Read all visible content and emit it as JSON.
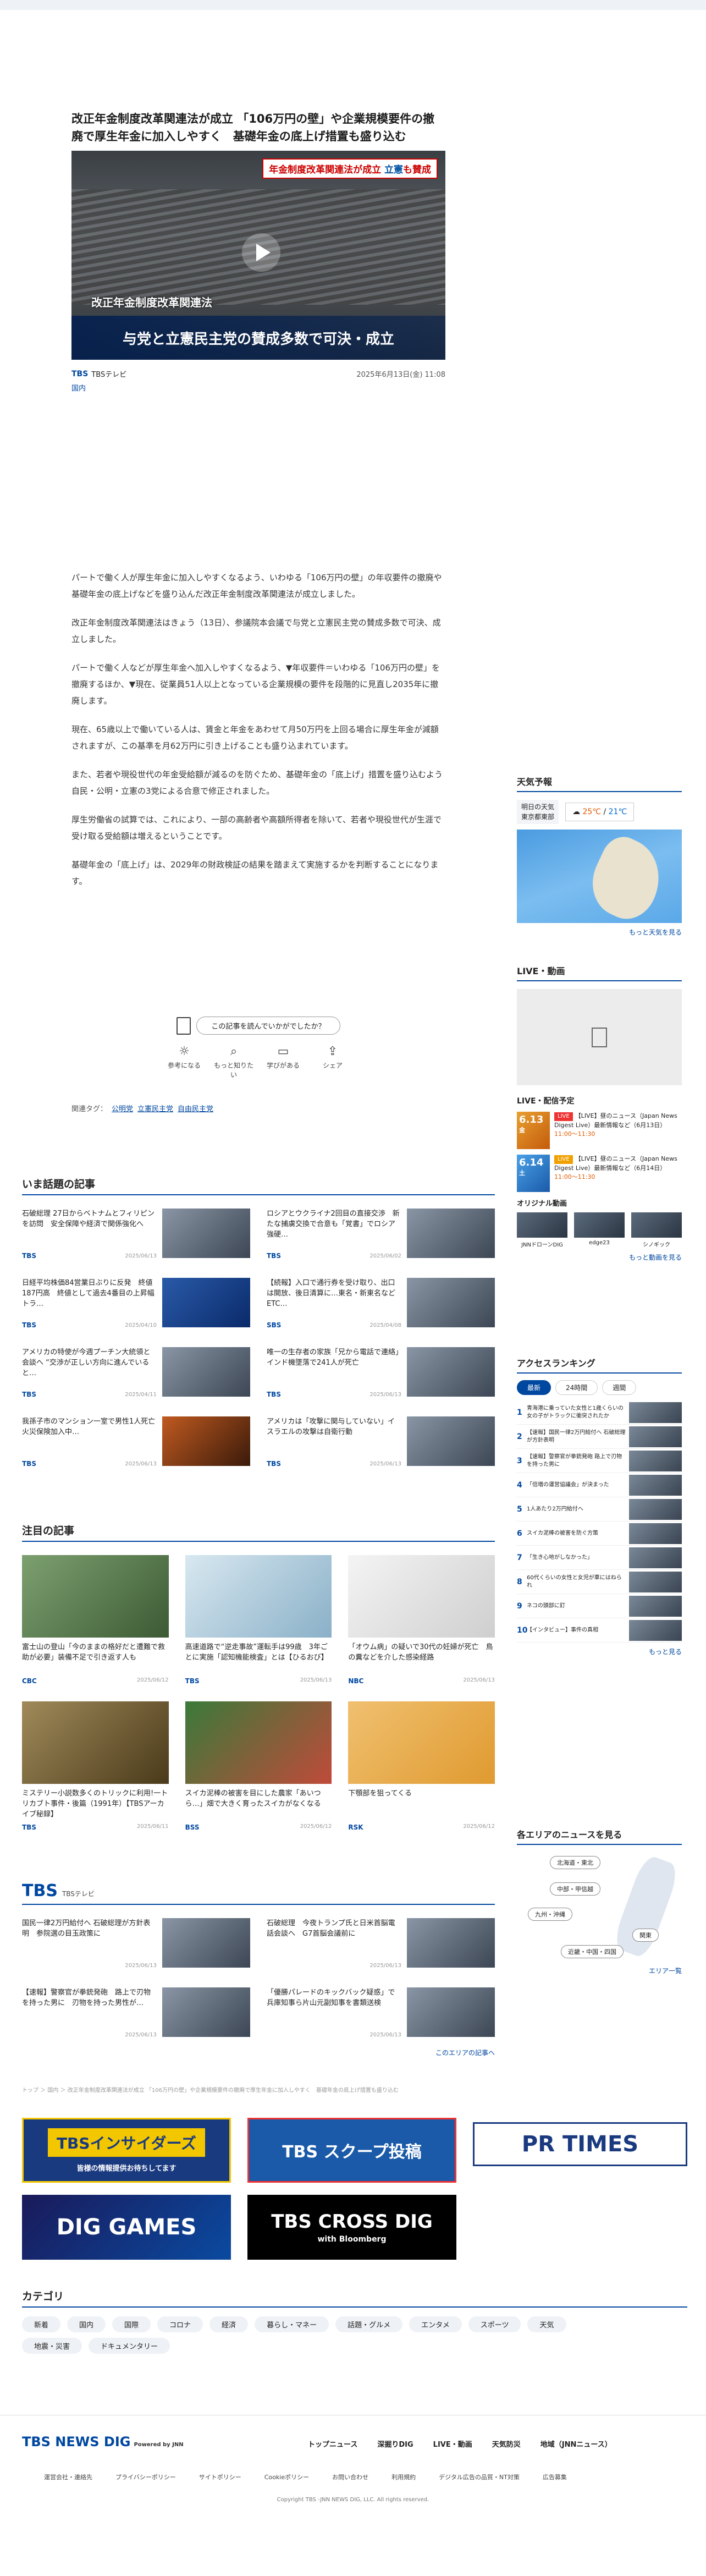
{
  "article": {
    "title": "改正年金制度改革関連法が成立 「106万円の壁」や企業規模要件の撤廃で厚生年金に加入しやすく　基礎年金の底上げ措置も盛り込む",
    "hero_badge_pre": "年金制度改革関連法が成立 ",
    "hero_badge_blue": "立憲",
    "hero_badge_post": "も賛成",
    "hero_caption1": "改正年金制度改革関連法",
    "hero_caption2": "与党と立憲民主党の賛成多数で可決・成立",
    "source_logo": "TBS",
    "source_name": "TBSテレビ",
    "date": "2025年6月13日(金) 11:08",
    "category": "国内",
    "paragraphs": [
      "パートで働く人が厚生年金に加入しやすくなるよう、いわゆる「106万円の壁」の年収要件の撤廃や基礎年金の底上げなどを盛り込んだ改正年金制度改革関連法が成立しました。",
      "改正年金制度改革関連法はきょう（13日）、参議院本会議で与党と立憲民主党の賛成多数で可決、成立しました。",
      "パートで働く人などが厚生年金へ加入しやすくなるよう、▼年収要件＝いわゆる「106万円の壁」を撤廃するほか、▼現在、従業員51人以上となっている企業規模の要件を段階的に見直し2035年に撤廃します。",
      "現在、65歳以上で働いている人は、賃金と年金をあわせて月50万円を上回る場合に厚生年金が減額されますが、この基準を月62万円に引き上げることも盛り込まれています。",
      "また、若者や現役世代の年金受給額が減るのを防ぐため、基礎年金の「底上げ」措置を盛り込むよう自民・公明・立憲の3党による合意で修正されました。",
      "厚生労働省の試算では、これにより、一部の高齢者や高額所得者を除いて、若者や現役世代が生涯で受け取る受給額は増えるということです。",
      "基礎年金の「底上げ」は、2029年の財政検証の結果を踏まえて実施するかを判断することになります。"
    ],
    "feedback_q": "この記事を読んでいかがでしたか？",
    "feedback": [
      "参考になる",
      "もっと知りたい",
      "学びがある",
      "シェア"
    ],
    "tags_label": "関連タグ：",
    "tags": [
      "公明党",
      "立憲民主党",
      "自由民主党"
    ]
  },
  "sidebar": {
    "weather_h": "天気予報",
    "weather_loc": "明日の天気",
    "weather_city": "東京都東部",
    "weather_hi": "25℃",
    "weather_lo": "21℃",
    "weather_more": "もっと天気を見る",
    "live_h": "LIVE・動画",
    "sched_h": "LIVE・配信予定",
    "sched": [
      {
        "date": "6.13",
        "day": "金",
        "label": "LIVE",
        "text": "【LIVE】昼のニュース（Japan News Digest Live）最新情報など（6月13日）",
        "time": "11:00～11:30"
      },
      {
        "date": "6.14",
        "day": "土",
        "label": "LIVE",
        "text": "【LIVE】昼のニュース（Japan News Digest Live）最新情報など（6月14日）",
        "time": "11:00～11:30"
      }
    ],
    "orig_h": "オリジナル動画",
    "orig": [
      "JNNドローンDIG",
      "edge23",
      "シノギック"
    ],
    "orig_more": "もっと動画を見る",
    "rank_h": "アクセスランキング",
    "rank_tabs": [
      "最新",
      "24時間",
      "週間"
    ],
    "rank": [
      "青海港に乗っていた女性と1歳くらいの女の子がトラックに衝突されたか",
      "【速報】国民一律2万円給付へ 石破総理が方針表明",
      "【速報】警察官が拳銃発砲 路上で刃物を持った男に",
      "「倍増の運営協議会」が決まった",
      "1人あたり2万円給付へ",
      "スイカ泥棒の被害を防ぐ方策",
      "「生き心地がしなかった」",
      "60代くらいの女性と女児が車にはねられ",
      "ネコの頭部に釘",
      "【インタビュー】事件の真相"
    ],
    "rank_more": "もっと見る",
    "area_h": "各エリアのニュースを見る",
    "areas": [
      "北海道・東北",
      "中部・甲信越",
      "九州・沖縄",
      "関東",
      "近畿・中国・四国"
    ],
    "area_more": "エリア一覧"
  },
  "hot": {
    "h": "いま話題の記事",
    "items": [
      {
        "t": "石破総理 27日からベトナムとフィリピンを訪問　安全保障や経済で関係強化へ",
        "s": "TBS",
        "d": "2025/06/13"
      },
      {
        "t": "ロシアとウクライナ2回目の直接交渉　新たな捕虜交換で合意も「覚書」でロシア強硬…",
        "s": "TBS",
        "d": "2025/06/02"
      },
      {
        "t": "日経平均株価84営業日ぶりに反発　終値187円高　終値として過去4番目の上昇幅　トラ…",
        "s": "TBS",
        "d": "2025/04/10"
      },
      {
        "t": "【続報】入口で通行券を受け取り、出口は開放、後日清算に…東名・新東名などETC…",
        "s": "SBS",
        "d": "2025/04/08"
      },
      {
        "t": "アメリカの特使が今週プーチン大統領と会談へ “交渉が正しい方向に進んでいると…",
        "s": "TBS",
        "d": "2025/04/11"
      },
      {
        "t": "唯一の生存者の家族「兄から電話で連絡」インド機墜落で241人が死亡",
        "s": "TBS",
        "d": "2025/06/13"
      },
      {
        "t": "我孫子市のマンション一室で男性1人死亡　火災保険加入中…",
        "s": "TBS",
        "d": "2025/06/13"
      },
      {
        "t": "アメリカは「攻撃に関与していない」イスラエルの攻撃は自衛行動",
        "s": "TBS",
        "d": "2025/06/13"
      }
    ]
  },
  "notable": {
    "h": "注目の記事",
    "items": [
      {
        "t": "富士山の登山「今のままの格好だと遭難で救助が必要」装備不足で引き返す人も",
        "s": "CBC",
        "d": "2025/06/12"
      },
      {
        "t": "高速道路で“逆走事故”運転手は99歳　3年ごとに実施「認知機能検査」とは【ひるおび】",
        "s": "TBS",
        "d": "2025/06/13"
      },
      {
        "t": "「オウム病」の疑いで30代の妊婦が死亡　鳥の糞などを介した感染経路",
        "s": "NBC",
        "d": "2025/06/13"
      },
      {
        "t": "ミステリー小説数多くのトリックに利用!一トリカブト事件・後篇（1991年）【TBSアーカイブ秘録】",
        "s": "TBS",
        "d": "2025/06/11"
      },
      {
        "t": "スイカ泥棒の被害を目にした農家「あいつら…」畑で大きく育ったスイカがなくなる",
        "s": "BSS",
        "d": "2025/06/12"
      },
      {
        "t": "下顎部を狙ってくる",
        "s": "RSK",
        "d": "2025/06/12"
      }
    ]
  },
  "tbs": {
    "h": "TBS",
    "sub": "TBSテレビ",
    "items": [
      {
        "t": "国民一律2万円給付へ 石破総理が方針表明　参院選の目玉政策に",
        "d": "2025/06/13"
      },
      {
        "t": "石破総理　今夜トランプ氏と日米首脳電話会談へ　G7首脳会議前に",
        "d": "2025/06/13"
      },
      {
        "t": "【速報】警察官が拳銃発砲　路上で刃物を持った男に　刃物を持った男性が…",
        "d": "2025/06/13"
      },
      {
        "t": "「優勝パレードのキックバック疑惑」で兵庫知事ら片山元副知事を書類送検",
        "d": "2025/06/13"
      }
    ],
    "more": "このエリアの記事へ"
  },
  "crumbs": "トップ ＞ 国内 ＞ 改正年金制度改革関連法が成立 「106万円の壁」や企業規模要件の撤廃で厚生年金に加入しやすく　基礎年金の底上げ措置も盛り込む",
  "banners": {
    "b1": "TBSインサイダーズ",
    "b1_sub": "皆様の情報提供お待ちしてます",
    "b2": "TBS スクープ投稿",
    "b3": "PR TIMES",
    "b4": "DIG GAMES",
    "b5": "TBS CROSS DIG",
    "b5_sub": "with Bloomberg"
  },
  "categories": {
    "h": "カテゴリ",
    "items": [
      "新着",
      "国内",
      "国際",
      "コロナ",
      "経済",
      "暮らし・マネー",
      "話題・グルメ",
      "エンタメ",
      "スポーツ",
      "天気",
      "地震・災害",
      "ドキュメンタリー"
    ]
  },
  "footer": {
    "logo": "TBS NEWS DIG",
    "logo_sub": "Powered by JNN",
    "nav": [
      "トップニュース",
      "深掘りDIG",
      "LIVE・動画",
      "天気防災",
      "地域（JNNニュース）"
    ],
    "links": [
      "運営会社・連絡先",
      "プライバシーポリシー",
      "サイトポリシー",
      "Cookieポリシー",
      "お問い合わせ",
      "利用規約",
      "デジタル広告の品質・NT対策",
      "広告募集"
    ],
    "copy": "Copyright TBS -JNN NEWS DIG, LLC. All rights reserved."
  },
  "colors": {
    "brand": "#0047a0"
  }
}
